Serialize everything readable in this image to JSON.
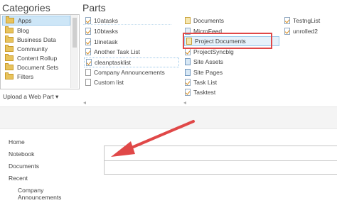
{
  "headers": {
    "categories": "Categories",
    "parts": "Parts"
  },
  "categories": [
    "Apps",
    "Blog",
    "Business Data",
    "Community",
    "Content Rollup",
    "Document Sets",
    "Filters"
  ],
  "selected_category": "Apps",
  "upload": {
    "label": "Upload a Web Part",
    "chevron": "▾"
  },
  "parts": {
    "col1": [
      "10atasks",
      "10btasks",
      "1linetask",
      "Another Task List",
      "cleanptasklist",
      "Company Announcements",
      "Custom list"
    ],
    "col2": [
      "Documents",
      "MicroFeed",
      "Project Documents",
      "ProjectSyncblg",
      "Site Assets",
      "Site Pages",
      "Task List",
      "Tasktest"
    ],
    "col3": [
      "TestngList",
      "unrolled2"
    ],
    "selected": "Project Documents"
  },
  "left_nav": [
    "Home",
    "Notebook",
    "Documents",
    "Recent"
  ],
  "left_nav_sub": [
    "Company",
    "Announcements"
  ],
  "colors": {
    "highlight": "#e04848",
    "selection": "#cde6f7",
    "accent": "#0072c6"
  },
  "icons": [
    "folder-icon",
    "list-check-icon",
    "document-library-icon",
    "scroll-arrow-icon",
    "red-arrow-annotation"
  ]
}
